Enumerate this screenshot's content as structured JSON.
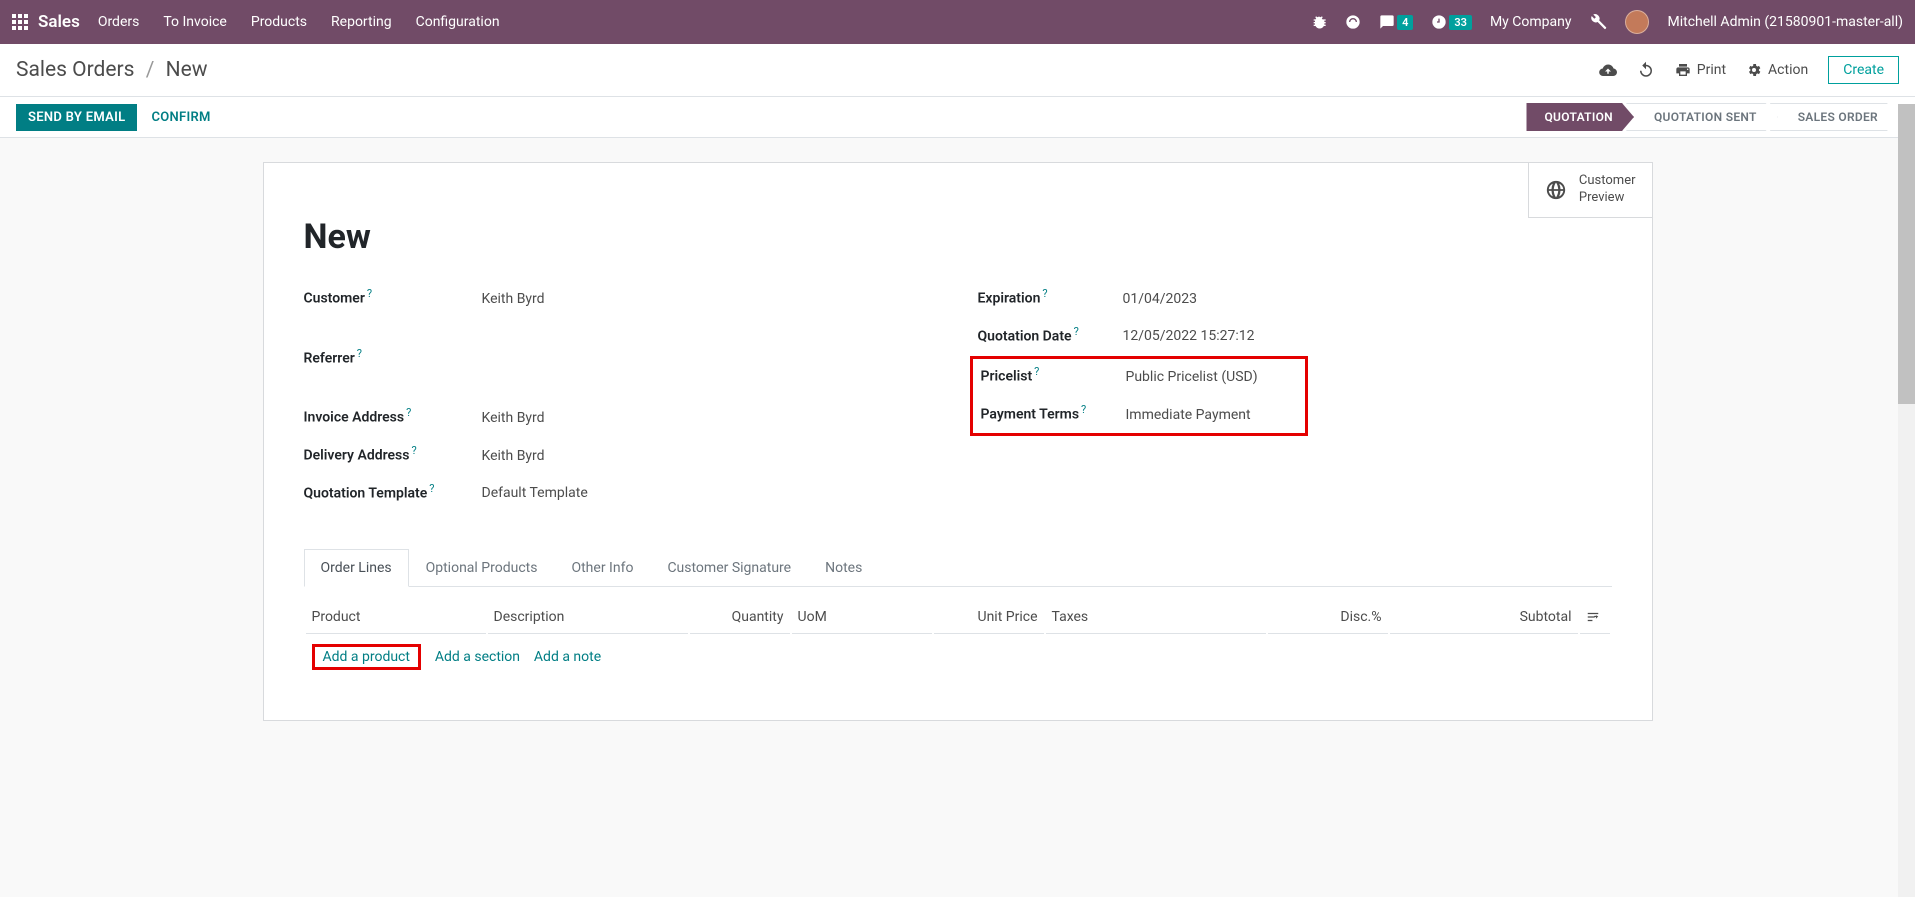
{
  "topnav": {
    "brand": "Sales",
    "menu": [
      "Orders",
      "To Invoice",
      "Products",
      "Reporting",
      "Configuration"
    ],
    "messages_badge": "4",
    "activities_badge": "33",
    "company": "My Company",
    "user": "Mitchell Admin (21580901-master-all)"
  },
  "breadcrumb": {
    "parent": "Sales Orders",
    "current": "New"
  },
  "breadcrumb_actions": {
    "print": "Print",
    "action": "Action",
    "create": "Create"
  },
  "statusbar": {
    "send": "SEND BY EMAIL",
    "confirm": "CONFIRM",
    "steps": [
      "QUOTATION",
      "QUOTATION SENT",
      "SALES ORDER"
    ]
  },
  "status_button": {
    "line1": "Customer",
    "line2": "Preview"
  },
  "record": {
    "title": "New",
    "left": {
      "customer_label": "Customer",
      "customer": "Keith Byrd",
      "referrer_label": "Referrer",
      "referrer": "",
      "invoice_addr_label": "Invoice Address",
      "invoice_addr": "Keith Byrd",
      "delivery_addr_label": "Delivery Address",
      "delivery_addr": "Keith Byrd",
      "quote_tmpl_label": "Quotation Template",
      "quote_tmpl": "Default Template"
    },
    "right": {
      "expiration_label": "Expiration",
      "expiration": "01/04/2023",
      "quote_date_label": "Quotation Date",
      "quote_date": "12/05/2022 15:27:12",
      "pricelist_label": "Pricelist",
      "pricelist": "Public Pricelist (USD)",
      "payment_terms_label": "Payment Terms",
      "payment_terms": "Immediate Payment"
    }
  },
  "tabs": [
    "Order Lines",
    "Optional Products",
    "Other Info",
    "Customer Signature",
    "Notes"
  ],
  "table": {
    "headers": {
      "product": "Product",
      "description": "Description",
      "quantity": "Quantity",
      "uom": "UoM",
      "unit_price": "Unit Price",
      "taxes": "Taxes",
      "disc": "Disc.%",
      "subtotal": "Subtotal"
    },
    "add_product": "Add a product",
    "add_section": "Add a section",
    "add_note": "Add a note"
  }
}
